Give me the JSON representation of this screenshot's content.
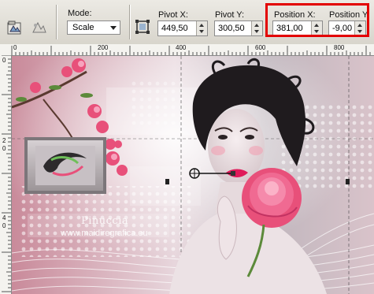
{
  "toolbar": {
    "mode_label": "Mode:",
    "mode_value": "Scale",
    "pivot_x_label": "Pivot X:",
    "pivot_x_value": "449,50",
    "pivot_y_label": "Pivot Y:",
    "pivot_y_value": "300,50",
    "position_x_label": "Position X:",
    "position_x_value": "381,00",
    "position_y_label": "Position Y:",
    "position_y_value": "-9,00"
  },
  "ruler": {
    "top_labels": [
      "0",
      "200",
      "400",
      "600",
      "800"
    ],
    "left_labels": [
      "0",
      "2",
      "0",
      "4",
      "0"
    ]
  },
  "canvas": {
    "watermark_name": "Pinuccia",
    "watermark_site": "www.maidiregrafica.eu"
  },
  "colors": {
    "highlight": "#e30000",
    "bg_pink": "#c98a9a",
    "flower": "#e8507a"
  }
}
